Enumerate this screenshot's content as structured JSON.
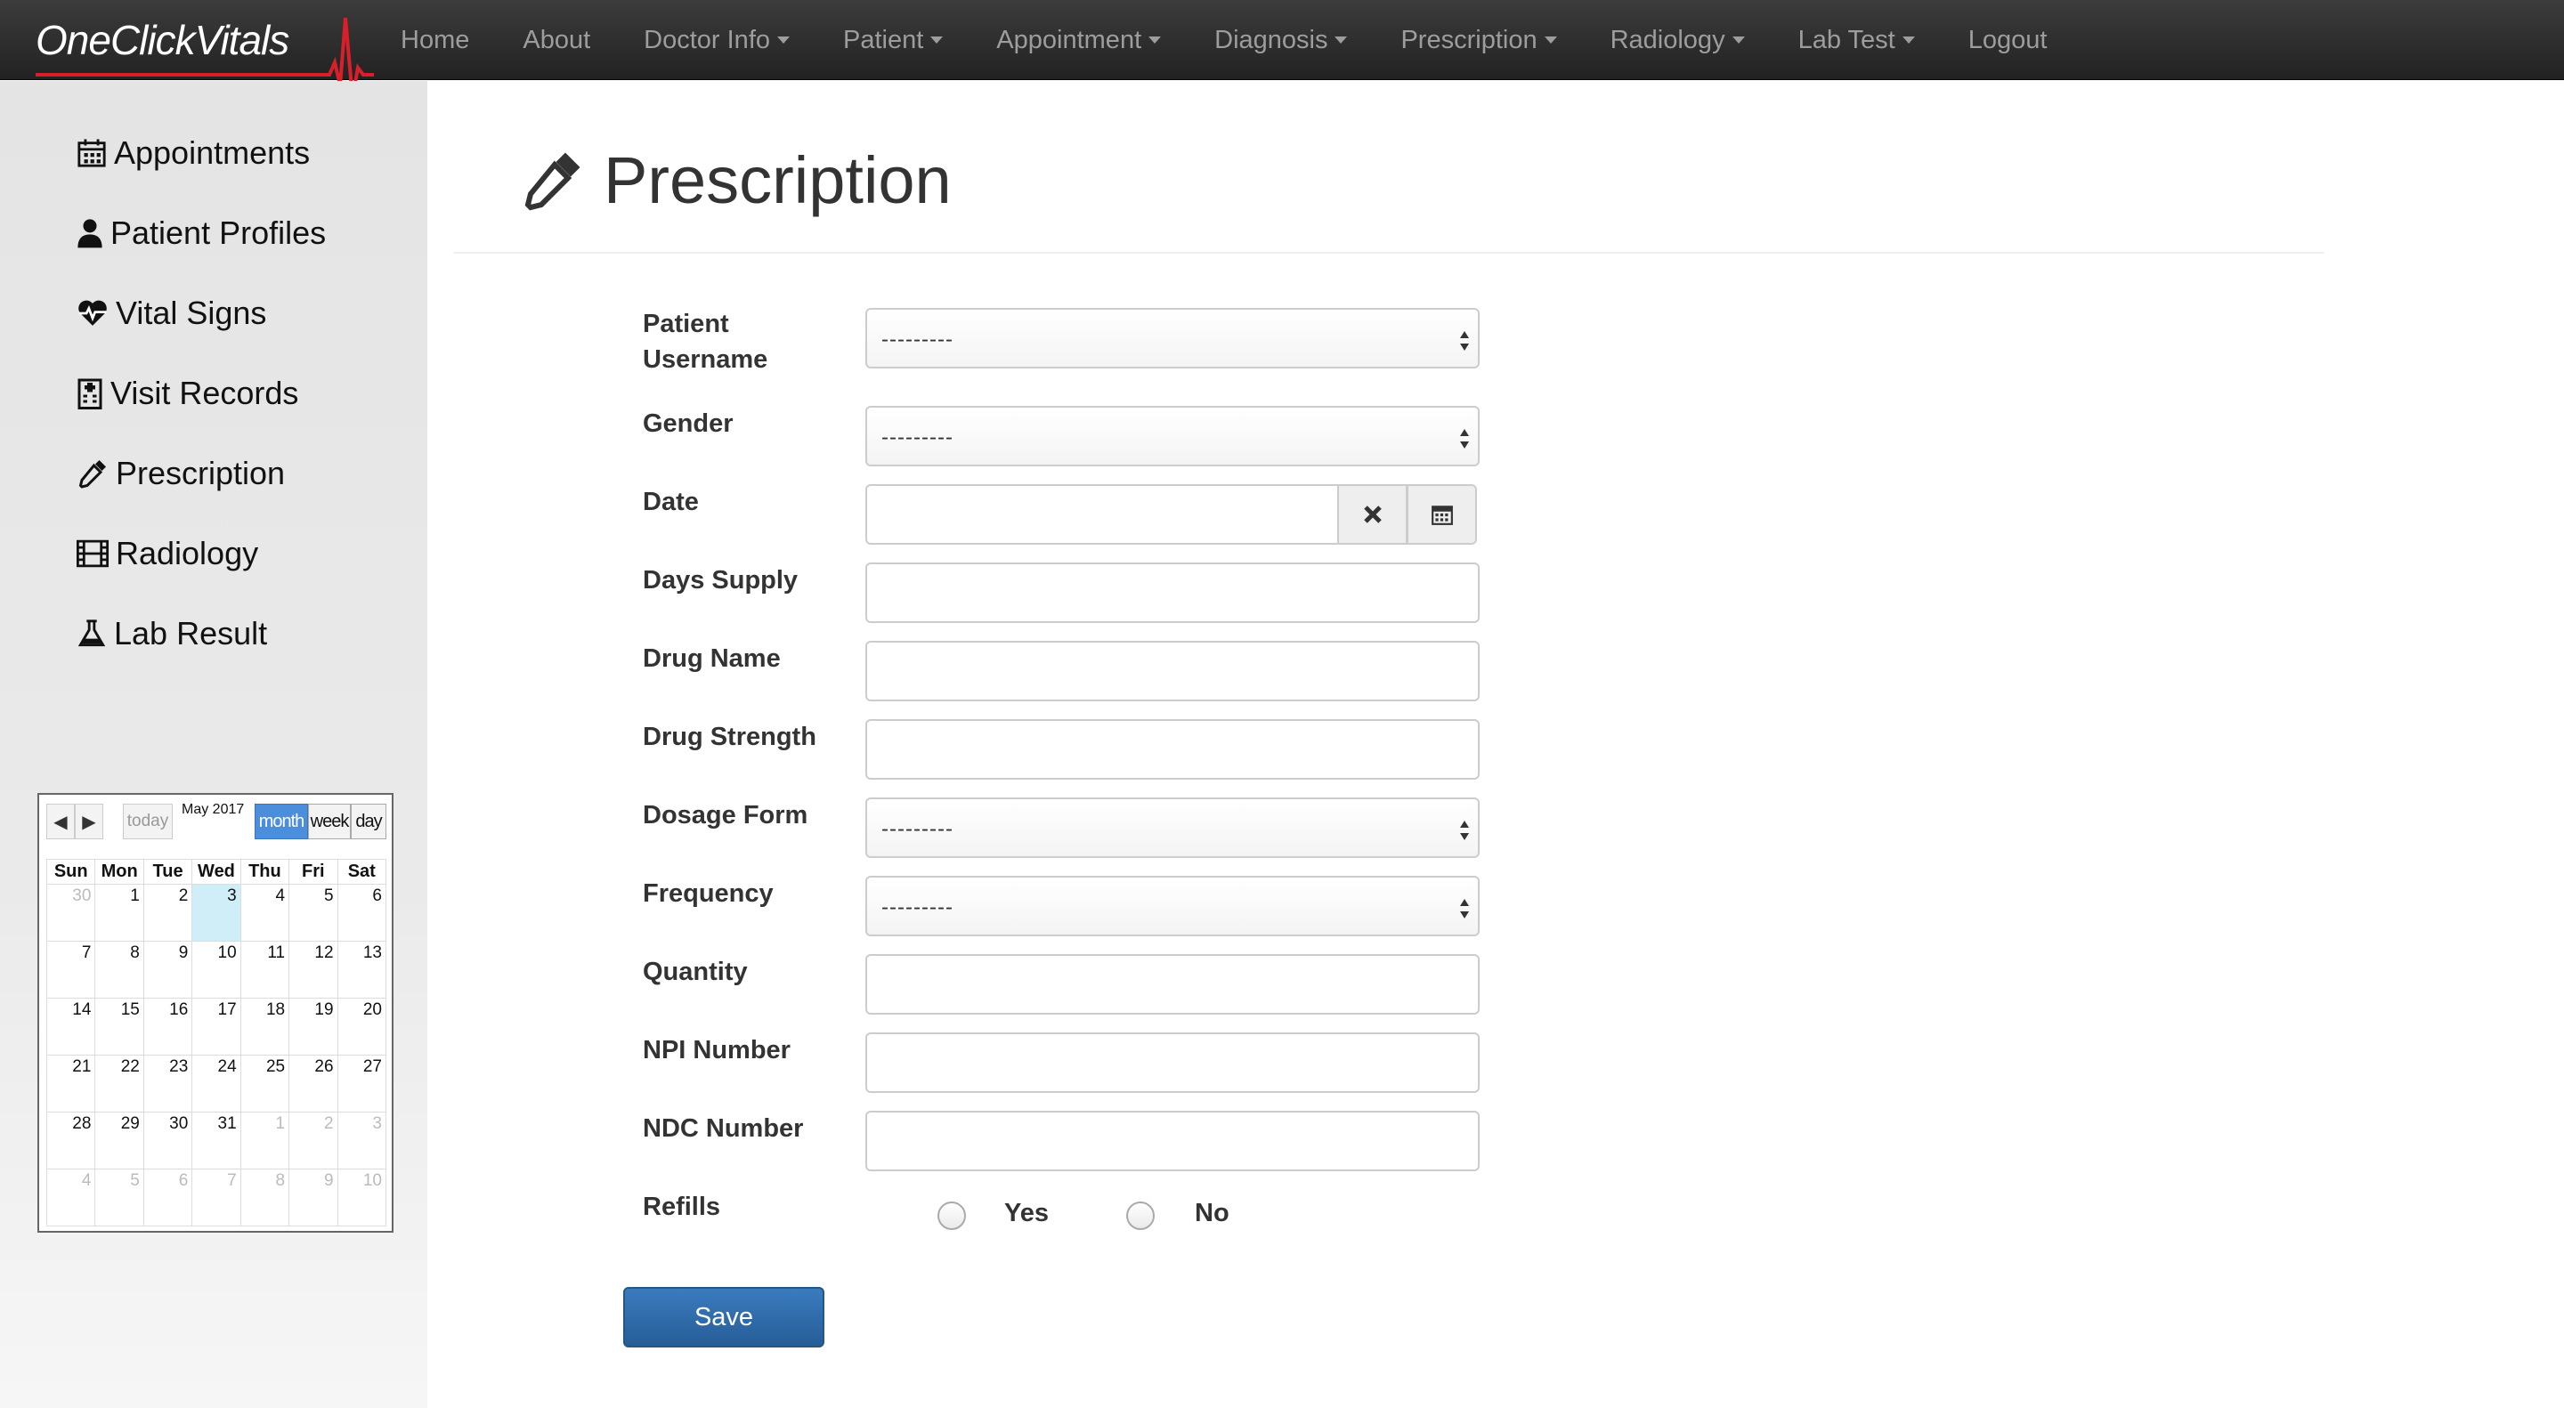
{
  "brand": {
    "name": "OneClickVitals"
  },
  "navbar": {
    "items": [
      {
        "label": "Home",
        "dropdown": false
      },
      {
        "label": "About",
        "dropdown": false
      },
      {
        "label": "Doctor Info",
        "dropdown": true
      },
      {
        "label": "Patient",
        "dropdown": true
      },
      {
        "label": "Appointment",
        "dropdown": true
      },
      {
        "label": "Diagnosis",
        "dropdown": true
      },
      {
        "label": "Prescription",
        "dropdown": true
      },
      {
        "label": "Radiology",
        "dropdown": true
      },
      {
        "label": "Lab Test",
        "dropdown": true
      },
      {
        "label": "Logout",
        "dropdown": false
      }
    ]
  },
  "sidebar": {
    "items": [
      {
        "label": "Appointments",
        "icon": "calendar-icon"
      },
      {
        "label": "Patient Profiles",
        "icon": "user-icon"
      },
      {
        "label": "Vital Signs",
        "icon": "heartbeat-icon"
      },
      {
        "label": "Visit Records",
        "icon": "hospital-icon"
      },
      {
        "label": "Prescription",
        "icon": "eyedropper-icon"
      },
      {
        "label": "Radiology",
        "icon": "film-icon"
      },
      {
        "label": "Lab Result",
        "icon": "flask-icon"
      }
    ]
  },
  "calendar": {
    "title": "May 2017",
    "today_label": "today",
    "views": [
      "month",
      "week",
      "day"
    ],
    "active_view": "month",
    "weekdays": [
      "Sun",
      "Mon",
      "Tue",
      "Wed",
      "Thu",
      "Fri",
      "Sat"
    ],
    "weeks": [
      [
        30,
        1,
        2,
        3,
        4,
        5,
        6
      ],
      [
        7,
        8,
        9,
        10,
        11,
        12,
        13
      ],
      [
        14,
        15,
        16,
        17,
        18,
        19,
        20
      ],
      [
        21,
        22,
        23,
        24,
        25,
        26,
        27
      ],
      [
        28,
        29,
        30,
        31,
        1,
        2,
        3
      ],
      [
        4,
        5,
        6,
        7,
        8,
        9,
        10
      ]
    ],
    "today": 3
  },
  "page": {
    "title": "Prescription",
    "icon": "eyedropper-icon"
  },
  "form": {
    "patient_username": {
      "label": "Patient Username",
      "value": "---------"
    },
    "gender": {
      "label": "Gender",
      "value": "---------"
    },
    "date": {
      "label": "Date",
      "value": ""
    },
    "days_supply": {
      "label": "Days Supply",
      "value": ""
    },
    "drug_name": {
      "label": "Drug Name",
      "value": ""
    },
    "drug_strength": {
      "label": "Drug Strength",
      "value": ""
    },
    "dosage_form": {
      "label": "Dosage Form",
      "value": "---------"
    },
    "frequency": {
      "label": "Frequency",
      "value": "---------"
    },
    "quantity": {
      "label": "Quantity",
      "value": ""
    },
    "npi_number": {
      "label": "NPI Number",
      "value": ""
    },
    "ndc_number": {
      "label": "NDC Number",
      "value": ""
    },
    "refills": {
      "label": "Refills",
      "options": [
        "Yes",
        "No"
      ],
      "selected": null
    },
    "save_label": "Save"
  },
  "colors": {
    "navbar": "#222222",
    "primary_button": "#2d6ca8",
    "brand_pulse": "#d9202a",
    "today_cell": "#cfeef8"
  }
}
